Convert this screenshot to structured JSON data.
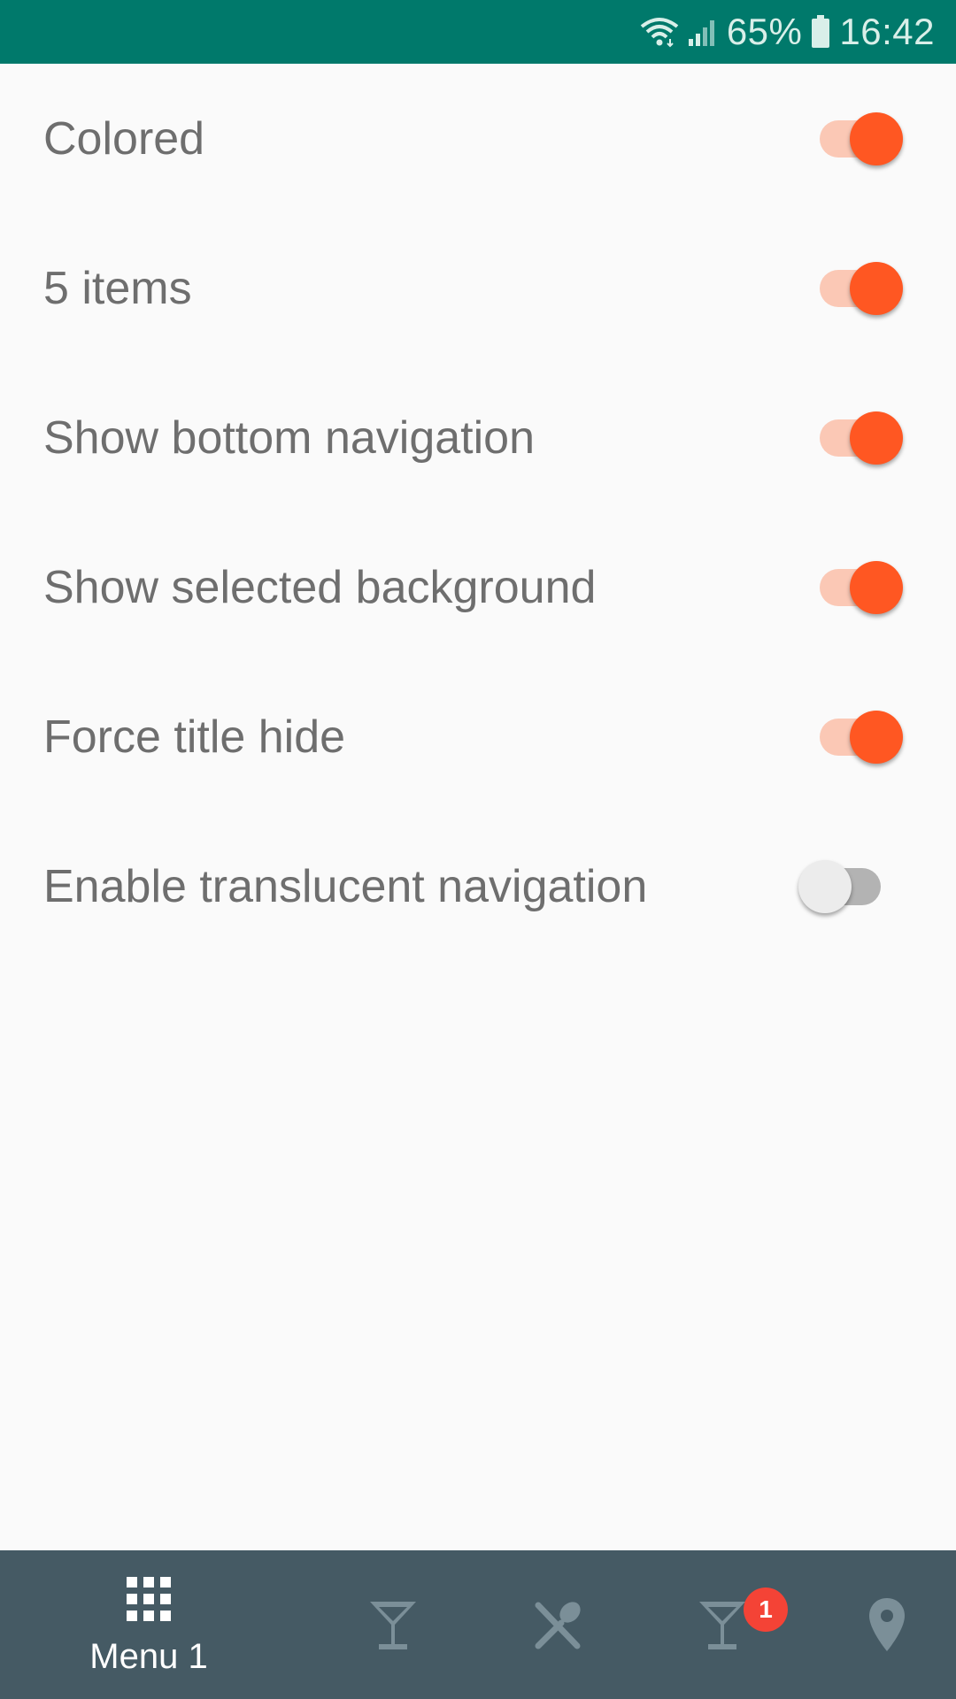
{
  "status_bar": {
    "battery": "65%",
    "time": "16:42",
    "icons": [
      "wifi-icon",
      "signal-icon",
      "battery-icon"
    ],
    "background": "#00796b"
  },
  "settings": [
    {
      "label": "Colored",
      "on": true
    },
    {
      "label": "5 items",
      "on": true
    },
    {
      "label": "Show bottom navigation",
      "on": true
    },
    {
      "label": "Show selected background",
      "on": true
    },
    {
      "label": "Force title hide",
      "on": true
    },
    {
      "label": "Enable translucent navigation",
      "on": false
    }
  ],
  "colors": {
    "accent": "#ff5722",
    "accent_track": "#fbc8b5",
    "nav_background": "#455a64",
    "badge": "#f44336"
  },
  "bottom_nav": {
    "items": [
      {
        "icon": "apps-grid-icon",
        "label": "Menu 1",
        "selected": true
      },
      {
        "icon": "cocktail-icon",
        "label": "",
        "selected": false
      },
      {
        "icon": "restaurant-icon",
        "label": "",
        "selected": false
      },
      {
        "icon": "cocktail-icon",
        "label": "",
        "selected": false,
        "badge": "1"
      },
      {
        "icon": "location-pin-icon",
        "label": "",
        "selected": false
      }
    ]
  }
}
